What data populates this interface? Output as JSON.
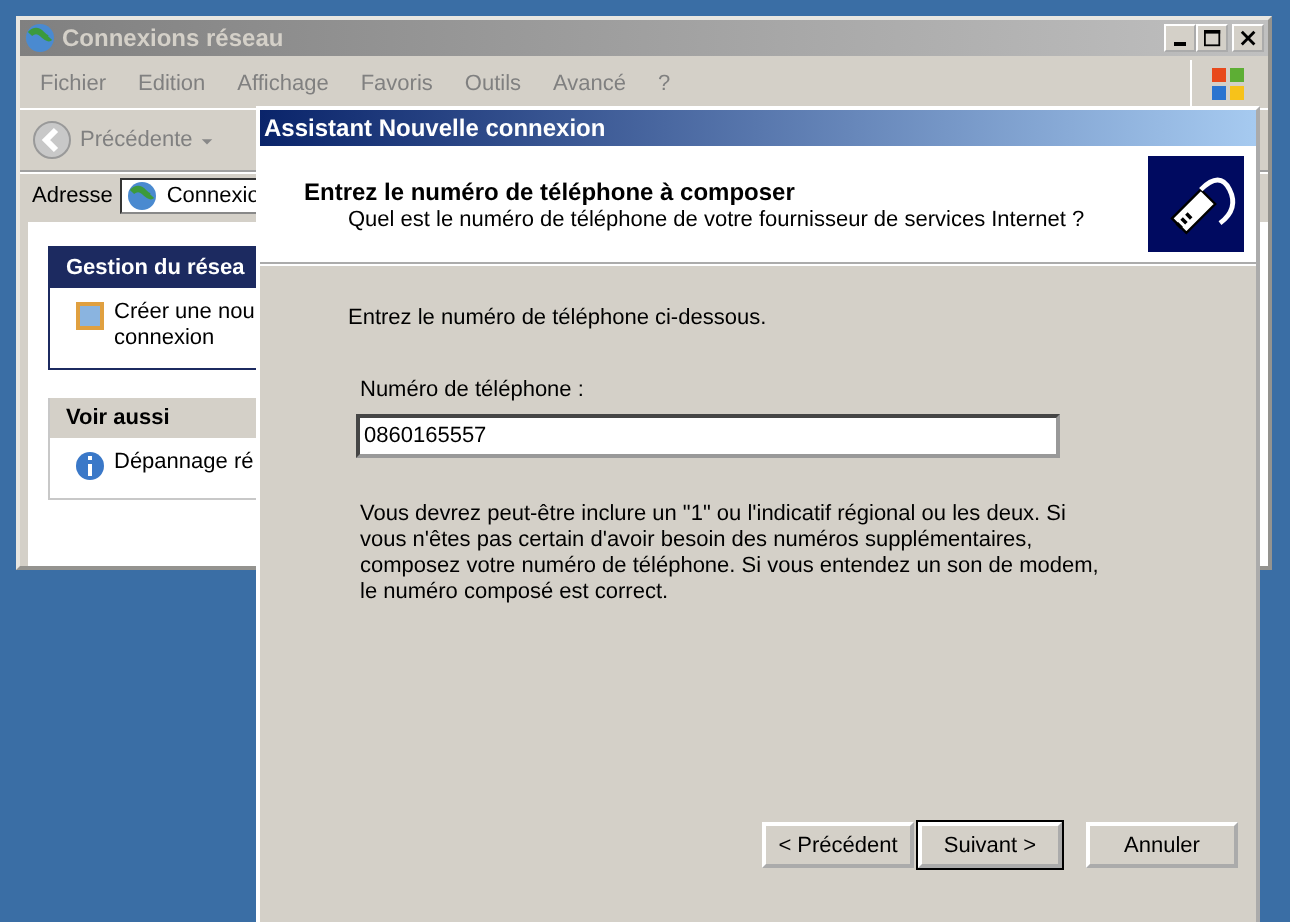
{
  "explorer": {
    "title": "Connexions réseau",
    "menu": [
      "Fichier",
      "Edition",
      "Affichage",
      "Favoris",
      "Outils",
      "Avancé",
      "?"
    ],
    "toolbar": {
      "back": "Précédente"
    },
    "address": {
      "label": "Adresse",
      "value": "Connexio"
    },
    "tasks": {
      "title": "Gestion du résea",
      "items": [
        {
          "text": "Créer une nou connexion"
        }
      ]
    },
    "see_also": {
      "title": "Voir aussi",
      "items": [
        {
          "text": "Dépannage ré"
        }
      ]
    }
  },
  "dialog": {
    "title": "Assistant Nouvelle connexion",
    "heading": "Entrez le numéro de téléphone à composer",
    "subheading": "Quel est le numéro de téléphone de votre fournisseur de services Internet ?",
    "intro": "Entrez le numéro de téléphone ci-dessous.",
    "field": {
      "label": "Numéro de téléphone :",
      "value": "0860165557"
    },
    "note": "Vous devrez peut-être inclure un \"1\" ou l'indicatif régional ou les deux. Si vous n'êtes pas certain d'avoir besoin des numéros supplémentaires, composez votre numéro de téléphone. Si vous entendez un son de modem, le numéro composé est correct.",
    "buttons": [
      {
        "label": "< Précédent",
        "default": false
      },
      {
        "label": "Suivant >",
        "default": true
      },
      {
        "label": "Annuler",
        "default": false
      }
    ]
  }
}
